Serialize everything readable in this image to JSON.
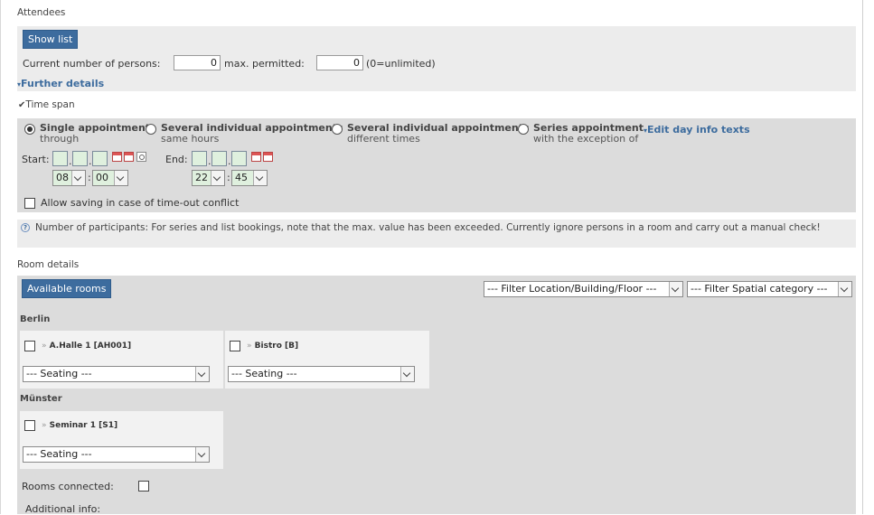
{
  "attendees": {
    "section_label": "Attendees",
    "show_list_label": "Show list",
    "current_persons_label": "Current number of persons:",
    "current_persons_value": "0",
    "max_permitted_label": "max. permitted:",
    "max_permitted_value": "0",
    "unlimited_hint": "(0=unlimited)",
    "further_details_label": "Further details"
  },
  "time_span": {
    "section_label": "Time span",
    "options": [
      {
        "title": "Single appointment",
        "subtitle": "through",
        "selected": true
      },
      {
        "title": "Several individual appointments",
        "subtitle": "same hours",
        "selected": false
      },
      {
        "title": "Several individual appointments",
        "subtitle": "different times",
        "selected": false
      },
      {
        "title": "Series appointment",
        "subtitle": "with the exception of",
        "selected": false
      }
    ],
    "edit_day_info_label": "Edit day info texts",
    "start_label": "Start:",
    "end_label": "End:",
    "start_hour": "08",
    "start_minute": "00",
    "end_hour": "22",
    "end_minute": "45",
    "time_separator": ":",
    "date_separator": ".",
    "allow_saving_label": "Allow saving in case of time-out conflict"
  },
  "participants_note": "Number of participants: For series and list bookings, note that the max. value has been exceeded. Currently ignore persons in a room and carry out a manual check!",
  "room_details": {
    "section_label": "Room details",
    "available_rooms_label": "Available rooms",
    "filter_location": "--- Filter Location/Building/Floor ---",
    "filter_category": "--- Filter Spatial category ---",
    "groups": [
      {
        "city": "Berlin",
        "rooms": [
          {
            "name": "A.Halle 1 [AH001]",
            "seating": "--- Seating ---"
          },
          {
            "name": "Bistro [B]",
            "seating": "--- Seating ---"
          }
        ]
      },
      {
        "city": "Münster",
        "rooms": [
          {
            "name": "Seminar 1 [S1]",
            "seating": "--- Seating ---"
          }
        ]
      }
    ],
    "rooms_connected_label": "Rooms connected:",
    "additional_info_label": "Additional info:"
  },
  "colors": {
    "accent": "#3d6c9e",
    "panel": "#ececec",
    "panel_dark": "#dcdcdc",
    "date_field": "#dff0de"
  }
}
